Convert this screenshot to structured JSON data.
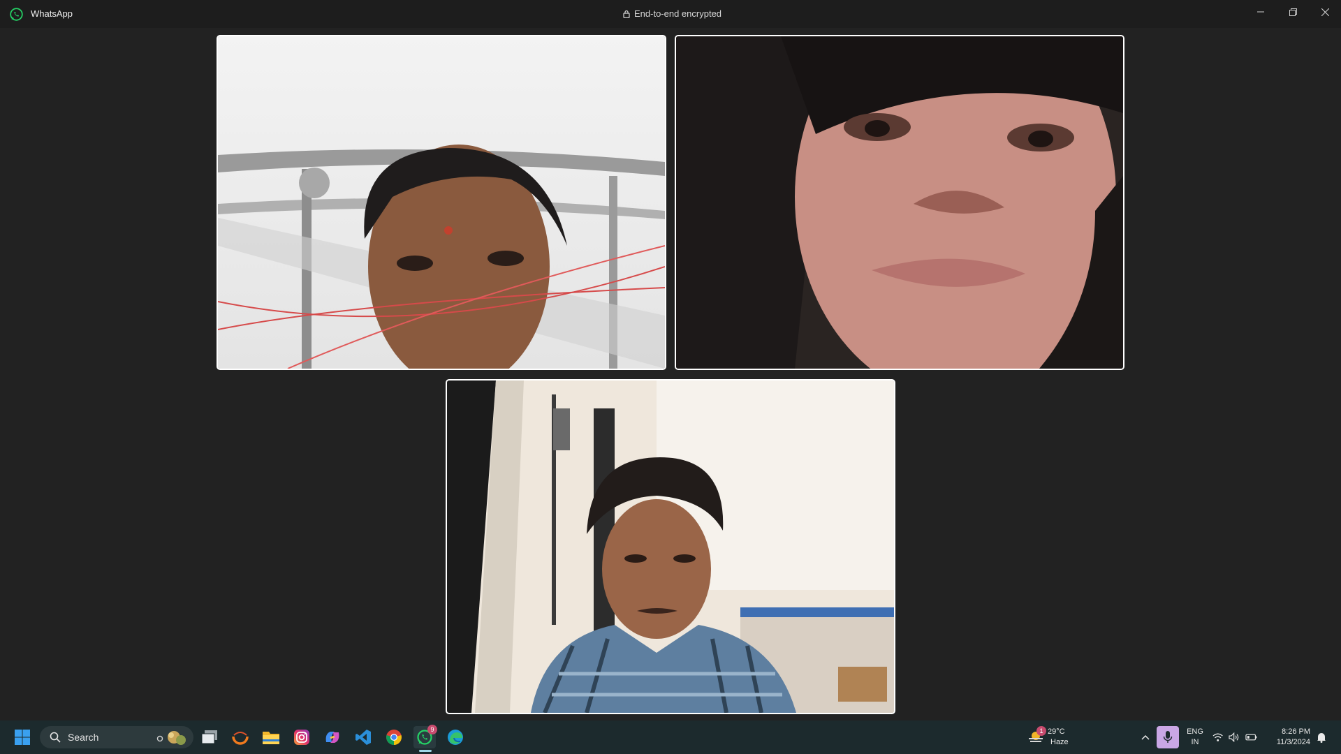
{
  "titlebar": {
    "app_name": "WhatsApp",
    "encryption_label": "End-to-end encrypted",
    "controls": [
      "minimize-icon",
      "restore-icon",
      "close-icon"
    ]
  },
  "call": {
    "participants": [
      {
        "tile": "participant-video-1"
      },
      {
        "tile": "participant-video-2"
      },
      {
        "tile": "participant-video-3"
      }
    ]
  },
  "taskbar": {
    "search_label": "Search",
    "pinned_apps": [
      "task-view-icon",
      "firefox-icon",
      "file-explorer-icon",
      "instagram-icon",
      "copilot-icon",
      "vscode-icon",
      "chrome-icon",
      "whatsapp-icon",
      "edge-icon"
    ],
    "whatsapp_badge": "9",
    "weather": {
      "temperature": "29°C",
      "condition": "Haze",
      "alert_badge": "1"
    },
    "language": {
      "line1": "ENG",
      "line2": "IN"
    },
    "clock": {
      "time": "8:26 PM",
      "date": "11/3/2024"
    }
  },
  "colors": {
    "background": "#222222",
    "titlebar": "#1d1d1d",
    "taskbar": "#1c2a2d",
    "whatsapp_green": "#25d366",
    "tile_border": "#ffffff"
  }
}
